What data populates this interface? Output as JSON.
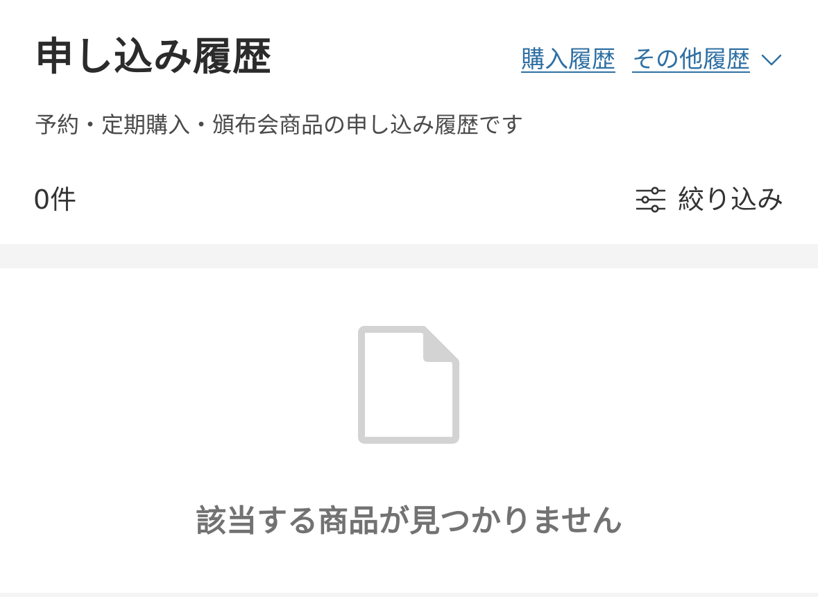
{
  "header": {
    "title": "申し込み履歴",
    "links": {
      "purchase_history": "購入履歴",
      "other_history": "その他履歴"
    },
    "subtitle": "予約・定期購入・頒布会商品の申し込み履歴です"
  },
  "results": {
    "count_label": "0件",
    "filter_label": "絞り込み"
  },
  "empty_state": {
    "message": "該当する商品が見つかりません"
  },
  "colors": {
    "link": "#2e6fa3",
    "title": "#2b2b2b",
    "muted": "#727272",
    "icon_gray": "#d3d3d3",
    "band": "#f4f4f4"
  },
  "icons": {
    "dropdown": "chevron-down-icon",
    "filter": "sliders-icon",
    "empty": "document-icon"
  }
}
